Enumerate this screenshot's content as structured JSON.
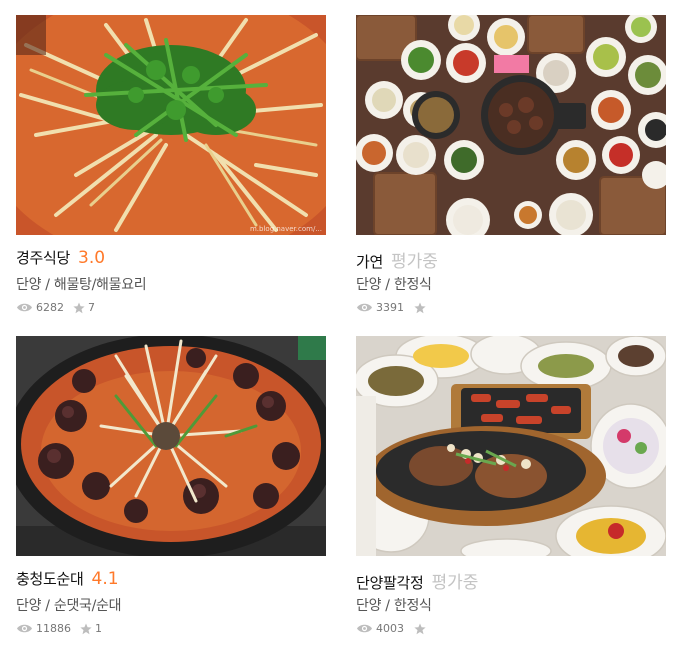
{
  "restaurants": [
    {
      "name": "경주식당",
      "score": "3.0",
      "category": "단양 / 해물탕/해물요리",
      "views": "6282",
      "favorites": "7",
      "photo_watermark": "m.blog.naver.com/..."
    },
    {
      "name": "가연",
      "score": "평가중",
      "category": "단양 / 한정식",
      "views": "3391",
      "favorites": ""
    },
    {
      "name": "충청도순대",
      "score": "4.1",
      "category": "단양 / 순댓국/순대",
      "views": "11886",
      "favorites": "1"
    },
    {
      "name": "단양팔각정",
      "score": "평가중",
      "category": "단양 / 한정식",
      "views": "4003",
      "favorites": ""
    }
  ],
  "icons": {
    "views": "eye-icon",
    "favorites": "star-icon"
  },
  "colors": {
    "score": "#ff792a",
    "pending": "#c4c4c4",
    "text": "#111111",
    "meta": "#555555"
  }
}
